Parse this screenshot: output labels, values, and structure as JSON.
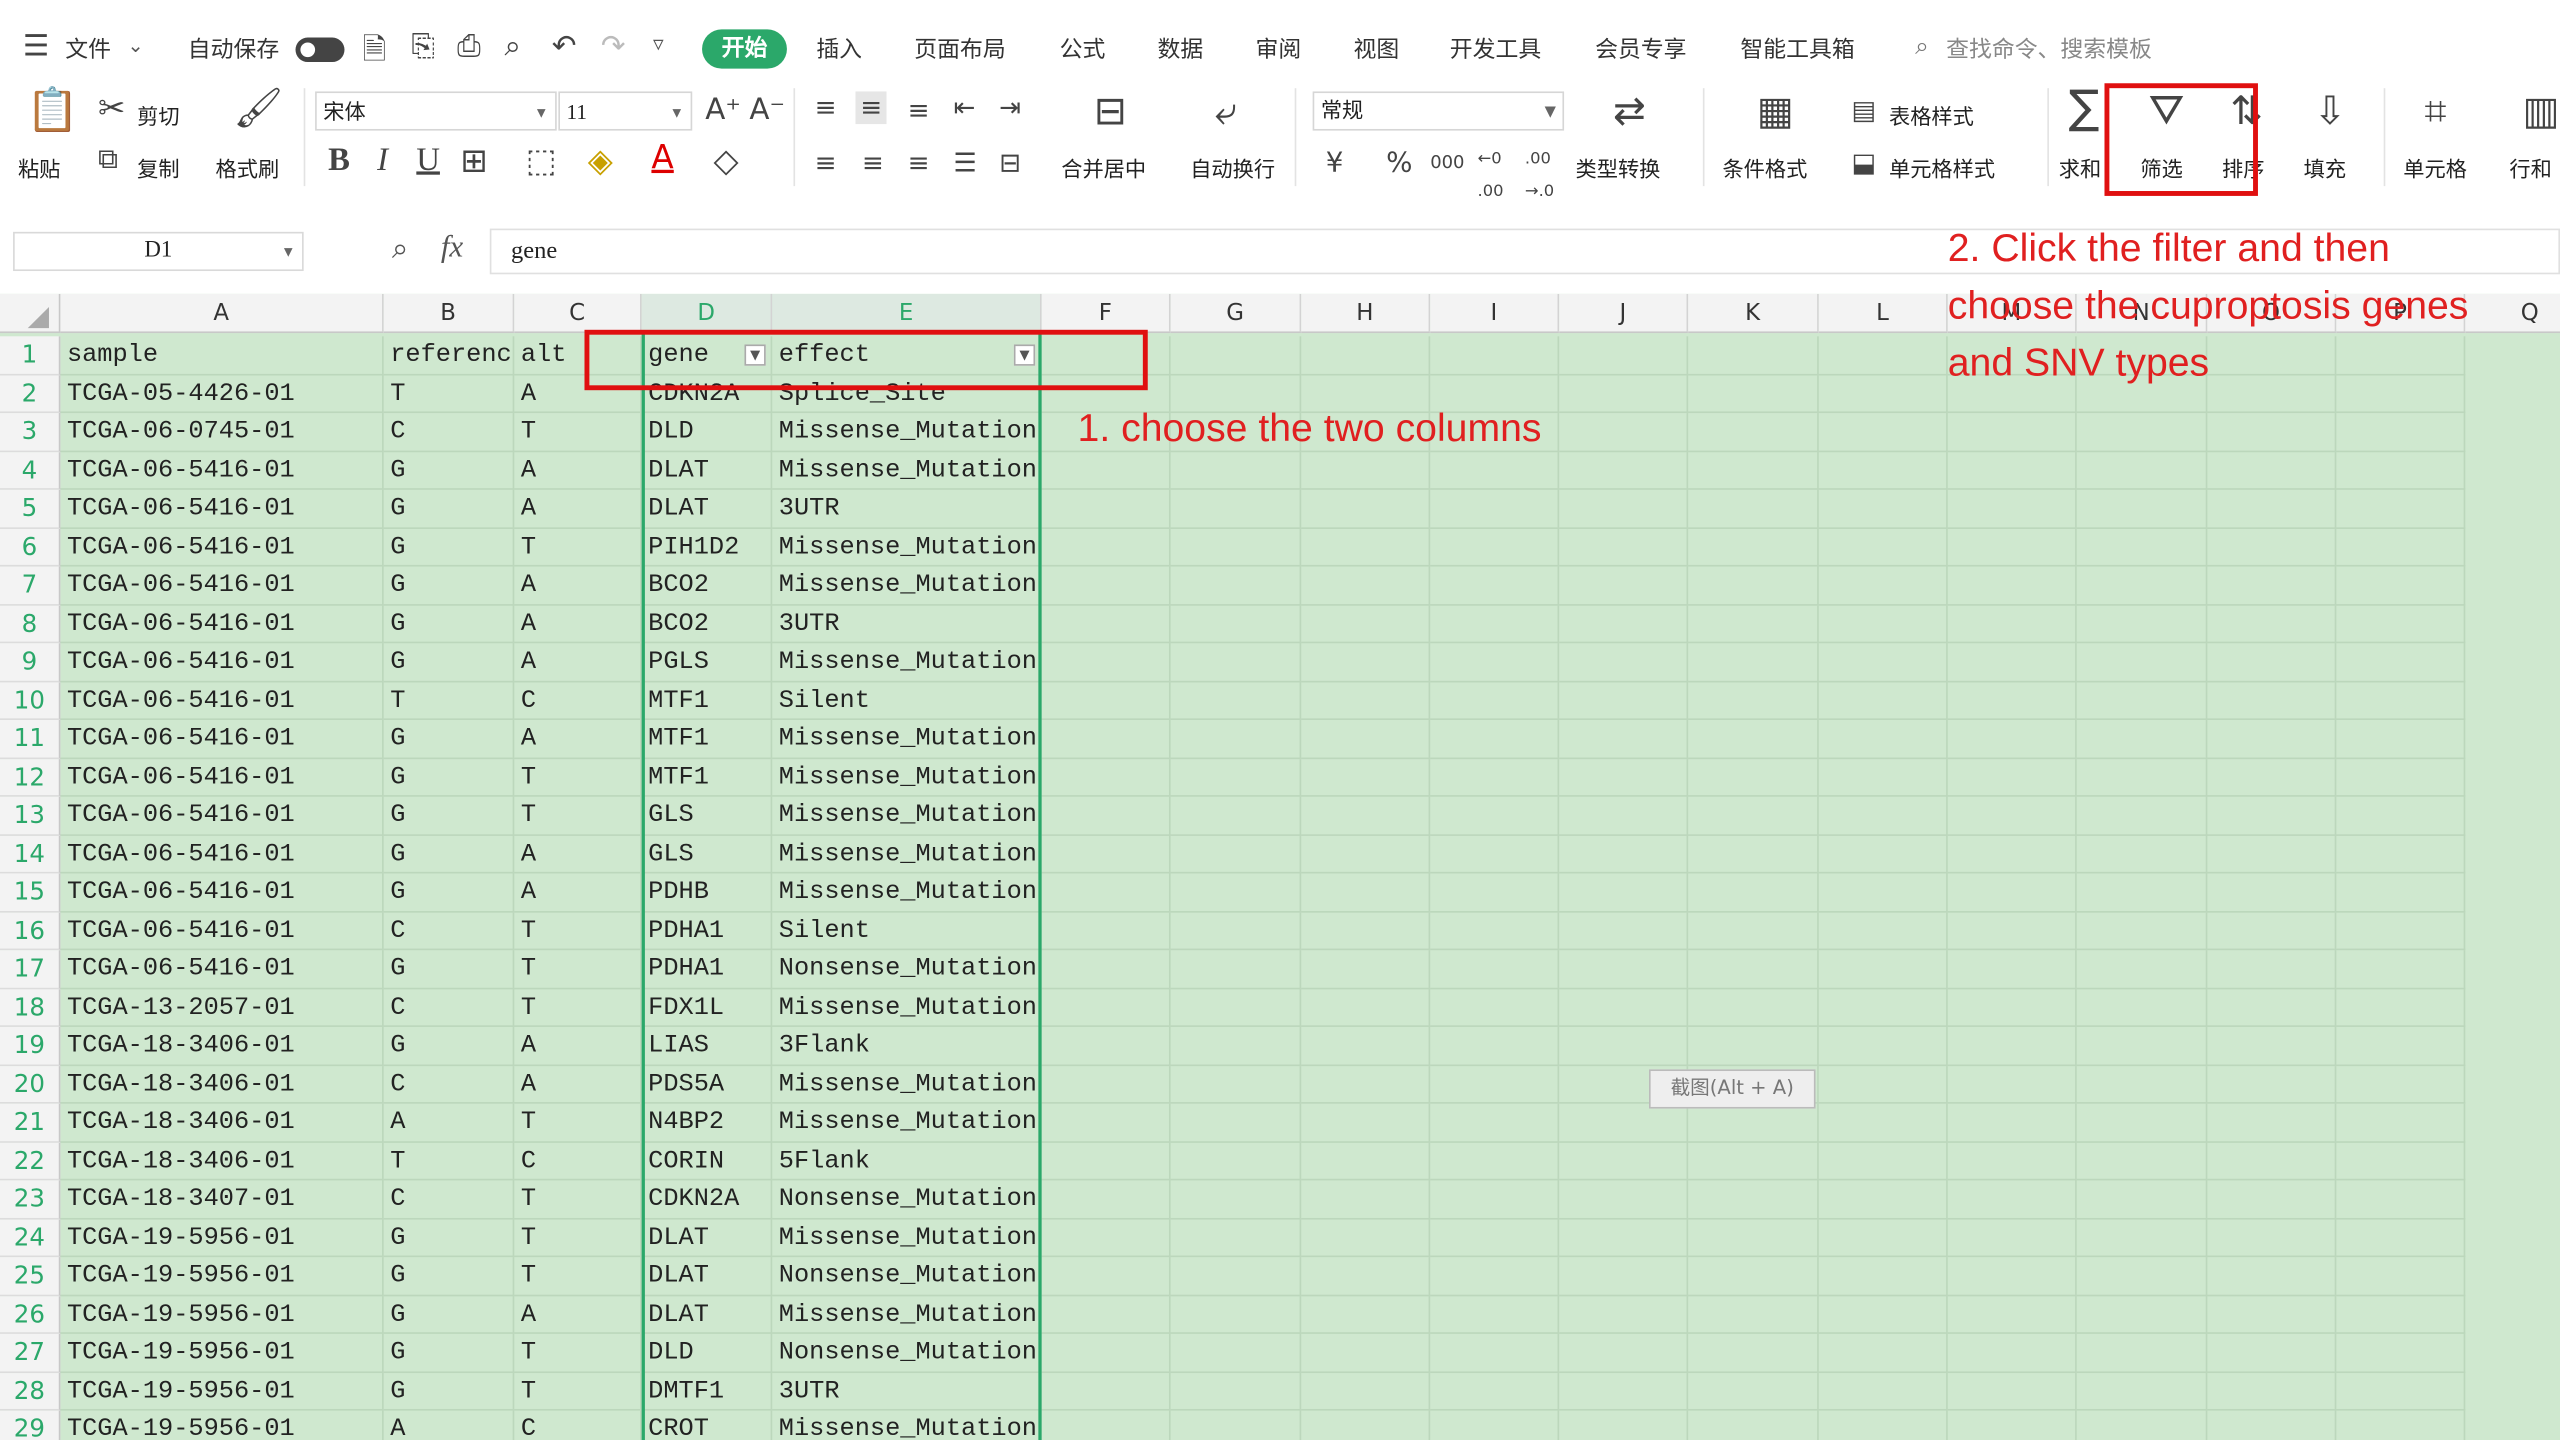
{
  "menubar": {
    "file": "文件",
    "autosave": "自动保存",
    "tabs": [
      "开始",
      "插入",
      "页面布局",
      "公式",
      "数据",
      "审阅",
      "视图",
      "开发工具",
      "会员专享",
      "智能工具箱"
    ],
    "search_placeholder": "查找命令、搜索模板"
  },
  "ribbon": {
    "paste": "粘贴",
    "cut": "剪切",
    "copy": "复制",
    "format_painter": "格式刷",
    "font_name": "宋体",
    "font_size": "11",
    "number_format": "常规",
    "merge_center": "合并居中",
    "wrap_text": "自动换行",
    "type_convert": "类型转换",
    "cond_format": "条件格式",
    "table_style": "表格样式",
    "cell_style": "单元格样式",
    "sum": "求和",
    "filter": "筛选",
    "sort": "排序",
    "fill": "填充",
    "cells": "单元格",
    "rows_cols": "行和"
  },
  "formula_bar": {
    "name_box": "D1",
    "fx": "fx",
    "content": "gene"
  },
  "grid": {
    "columns": [
      "A",
      "B",
      "C",
      "D",
      "E",
      "F",
      "G",
      "H",
      "I",
      "J",
      "K",
      "L",
      "M",
      "N",
      "O",
      "P",
      "Q"
    ],
    "header_row": [
      "sample",
      "reference",
      "alt",
      "gene",
      "effect"
    ],
    "rows": [
      [
        "TCGA-05-4426-01",
        "T",
        "A",
        "CDKN2A",
        "Splice_Site"
      ],
      [
        "TCGA-06-0745-01",
        "C",
        "T",
        "DLD",
        "Missense_Mutation"
      ],
      [
        "TCGA-06-5416-01",
        "G",
        "A",
        "DLAT",
        "Missense_Mutation"
      ],
      [
        "TCGA-06-5416-01",
        "G",
        "A",
        "DLAT",
        "3UTR"
      ],
      [
        "TCGA-06-5416-01",
        "G",
        "T",
        "PIH1D2",
        "Missense_Mutation"
      ],
      [
        "TCGA-06-5416-01",
        "G",
        "A",
        "BCO2",
        "Missense_Mutation"
      ],
      [
        "TCGA-06-5416-01",
        "G",
        "A",
        "BCO2",
        "3UTR"
      ],
      [
        "TCGA-06-5416-01",
        "G",
        "A",
        "PGLS",
        "Missense_Mutation"
      ],
      [
        "TCGA-06-5416-01",
        "T",
        "C",
        "MTF1",
        "Silent"
      ],
      [
        "TCGA-06-5416-01",
        "G",
        "A",
        "MTF1",
        "Missense_Mutation"
      ],
      [
        "TCGA-06-5416-01",
        "G",
        "T",
        "MTF1",
        "Missense_Mutation"
      ],
      [
        "TCGA-06-5416-01",
        "G",
        "T",
        "GLS",
        "Missense_Mutation"
      ],
      [
        "TCGA-06-5416-01",
        "G",
        "A",
        "GLS",
        "Missense_Mutation"
      ],
      [
        "TCGA-06-5416-01",
        "G",
        "A",
        "PDHB",
        "Missense_Mutation"
      ],
      [
        "TCGA-06-5416-01",
        "C",
        "T",
        "PDHA1",
        "Silent"
      ],
      [
        "TCGA-06-5416-01",
        "G",
        "T",
        "PDHA1",
        "Nonsense_Mutation"
      ],
      [
        "TCGA-13-2057-01",
        "C",
        "T",
        "FDX1L",
        "Missense_Mutation"
      ],
      [
        "TCGA-18-3406-01",
        "G",
        "A",
        "LIAS",
        "3Flank"
      ],
      [
        "TCGA-18-3406-01",
        "C",
        "A",
        "PDS5A",
        "Missense_Mutation"
      ],
      [
        "TCGA-18-3406-01",
        "A",
        "T",
        "N4BP2",
        "Missense_Mutation"
      ],
      [
        "TCGA-18-3406-01",
        "T",
        "C",
        "CORIN",
        "5Flank"
      ],
      [
        "TCGA-18-3407-01",
        "C",
        "T",
        "CDKN2A",
        "Nonsense_Mutation"
      ],
      [
        "TCGA-19-5956-01",
        "G",
        "T",
        "DLAT",
        "Missense_Mutation"
      ],
      [
        "TCGA-19-5956-01",
        "G",
        "T",
        "DLAT",
        "Nonsense_Mutation"
      ],
      [
        "TCGA-19-5956-01",
        "G",
        "A",
        "DLAT",
        "Missense_Mutation"
      ],
      [
        "TCGA-19-5956-01",
        "G",
        "T",
        "DLD",
        "Nonsense_Mutation"
      ],
      [
        "TCGA-19-5956-01",
        "G",
        "T",
        "DMTF1",
        "3UTR"
      ],
      [
        "TCGA-19-5956-01",
        "A",
        "C",
        "CROT",
        "Missense_Mutation"
      ]
    ]
  },
  "annotations": {
    "step1": "1. choose the two columns",
    "step2_line1": "2. Click the filter and then",
    "step2_line2": "choose the cuproptosis genes",
    "step2_line3": "and SNV types"
  },
  "tooltip": "截图(Alt + A)",
  "colors": {
    "accent": "#2ba86a",
    "annotation": "#e01010",
    "grid_bg": "#cfe8cf"
  }
}
